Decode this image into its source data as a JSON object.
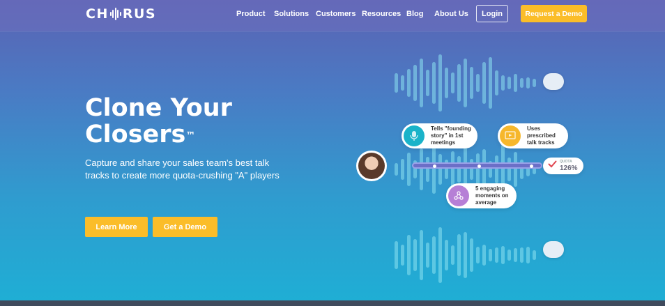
{
  "header": {
    "logo_text": "CHORUS",
    "nav": [
      {
        "label": "Product"
      },
      {
        "label": "Solutions"
      },
      {
        "label": "Customers"
      },
      {
        "label": "Resources"
      },
      {
        "label": "Blog"
      },
      {
        "label": "About Us"
      }
    ],
    "login_label": "Login",
    "demo_label": "Request a Demo"
  },
  "hero": {
    "title_line1": "Clone Your",
    "title_line2": "Closers",
    "trademark": "™",
    "subtitle": "Capture and share your sales team's best talk tracks to create more quota-crushing \"A\" players",
    "learn_more_label": "Learn More",
    "get_demo_label": "Get a Demo"
  },
  "illustration": {
    "bubble1_text": [
      "Tells \"founding",
      "story\" in 1st",
      "meetings"
    ],
    "bubble2_text": [
      "Uses",
      "prescribed",
      "talk tracks"
    ],
    "bubble3_text": [
      "5 engaging",
      "moments on",
      "average"
    ],
    "quota_label": "QUOTA",
    "quota_value": "126%",
    "colors": {
      "bubble1_icon": "#1ab3c9",
      "bubble2_icon": "#f6b72c",
      "bubble3_icon": "#b67fd6",
      "accent": "#fbbd29"
    },
    "icons": [
      "microphone-icon",
      "presentation-icon",
      "molecule-icon",
      "checkmark-icon"
    ]
  }
}
